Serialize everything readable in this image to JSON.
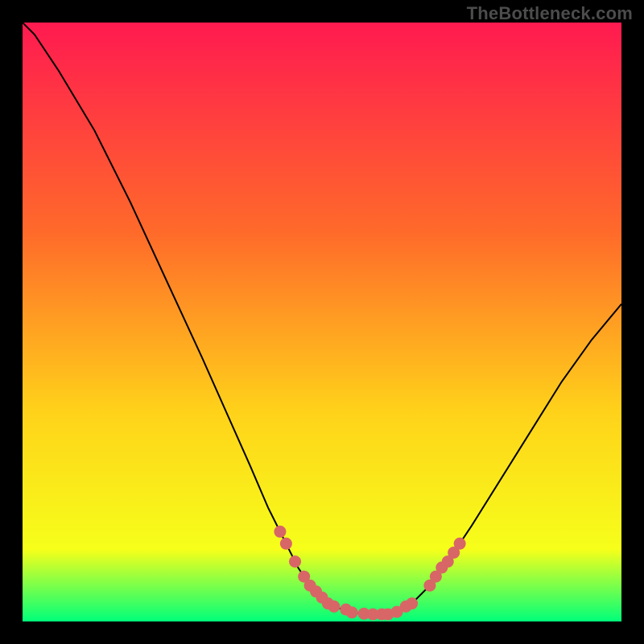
{
  "watermark": "TheBottleneck.com",
  "colors": {
    "background": "#000000",
    "gradient_top": "#ff1a50",
    "gradient_mid1": "#ff6a2a",
    "gradient_mid2": "#ffd21a",
    "gradient_mid3": "#f6ff1a",
    "gradient_bottom": "#00ff7a",
    "curve": "#000000",
    "marker_fill": "#d86666",
    "marker_stroke": "#d86666"
  },
  "chart_data": {
    "type": "line",
    "title": "",
    "xlabel": "",
    "ylabel": "",
    "xlim": [
      0,
      100
    ],
    "ylim": [
      0,
      100
    ],
    "grid": false,
    "curve_points": [
      {
        "x": 0,
        "y": 100
      },
      {
        "x": 2,
        "y": 98
      },
      {
        "x": 6,
        "y": 92
      },
      {
        "x": 12,
        "y": 82
      },
      {
        "x": 18,
        "y": 70
      },
      {
        "x": 24,
        "y": 57
      },
      {
        "x": 30,
        "y": 44
      },
      {
        "x": 34,
        "y": 35
      },
      {
        "x": 38,
        "y": 26
      },
      {
        "x": 41,
        "y": 19
      },
      {
        "x": 44,
        "y": 13
      },
      {
        "x": 46,
        "y": 9
      },
      {
        "x": 48,
        "y": 6
      },
      {
        "x": 50,
        "y": 4
      },
      {
        "x": 52,
        "y": 2.5
      },
      {
        "x": 55,
        "y": 1.5
      },
      {
        "x": 58,
        "y": 1.2
      },
      {
        "x": 60,
        "y": 1.2
      },
      {
        "x": 62,
        "y": 1.5
      },
      {
        "x": 65,
        "y": 3
      },
      {
        "x": 68,
        "y": 6
      },
      {
        "x": 71,
        "y": 10
      },
      {
        "x": 75,
        "y": 16
      },
      {
        "x": 80,
        "y": 24
      },
      {
        "x": 85,
        "y": 32
      },
      {
        "x": 90,
        "y": 40
      },
      {
        "x": 95,
        "y": 47
      },
      {
        "x": 100,
        "y": 53
      }
    ],
    "markers": [
      {
        "x": 43,
        "y": 15
      },
      {
        "x": 44,
        "y": 13
      },
      {
        "x": 45.5,
        "y": 10
      },
      {
        "x": 47,
        "y": 7.5
      },
      {
        "x": 48,
        "y": 6
      },
      {
        "x": 49,
        "y": 5
      },
      {
        "x": 50,
        "y": 4
      },
      {
        "x": 51,
        "y": 3
      },
      {
        "x": 52,
        "y": 2.5
      },
      {
        "x": 54,
        "y": 2
      },
      {
        "x": 55,
        "y": 1.5
      },
      {
        "x": 57,
        "y": 1.3
      },
      {
        "x": 58.5,
        "y": 1.2
      },
      {
        "x": 60,
        "y": 1.2
      },
      {
        "x": 61,
        "y": 1.2
      },
      {
        "x": 62.5,
        "y": 1.6
      },
      {
        "x": 64,
        "y": 2.5
      },
      {
        "x": 65,
        "y": 3
      },
      {
        "x": 68,
        "y": 6
      },
      {
        "x": 69,
        "y": 7.5
      },
      {
        "x": 70,
        "y": 9
      },
      {
        "x": 71,
        "y": 10
      },
      {
        "x": 72,
        "y": 11.5
      },
      {
        "x": 73,
        "y": 13
      }
    ]
  }
}
